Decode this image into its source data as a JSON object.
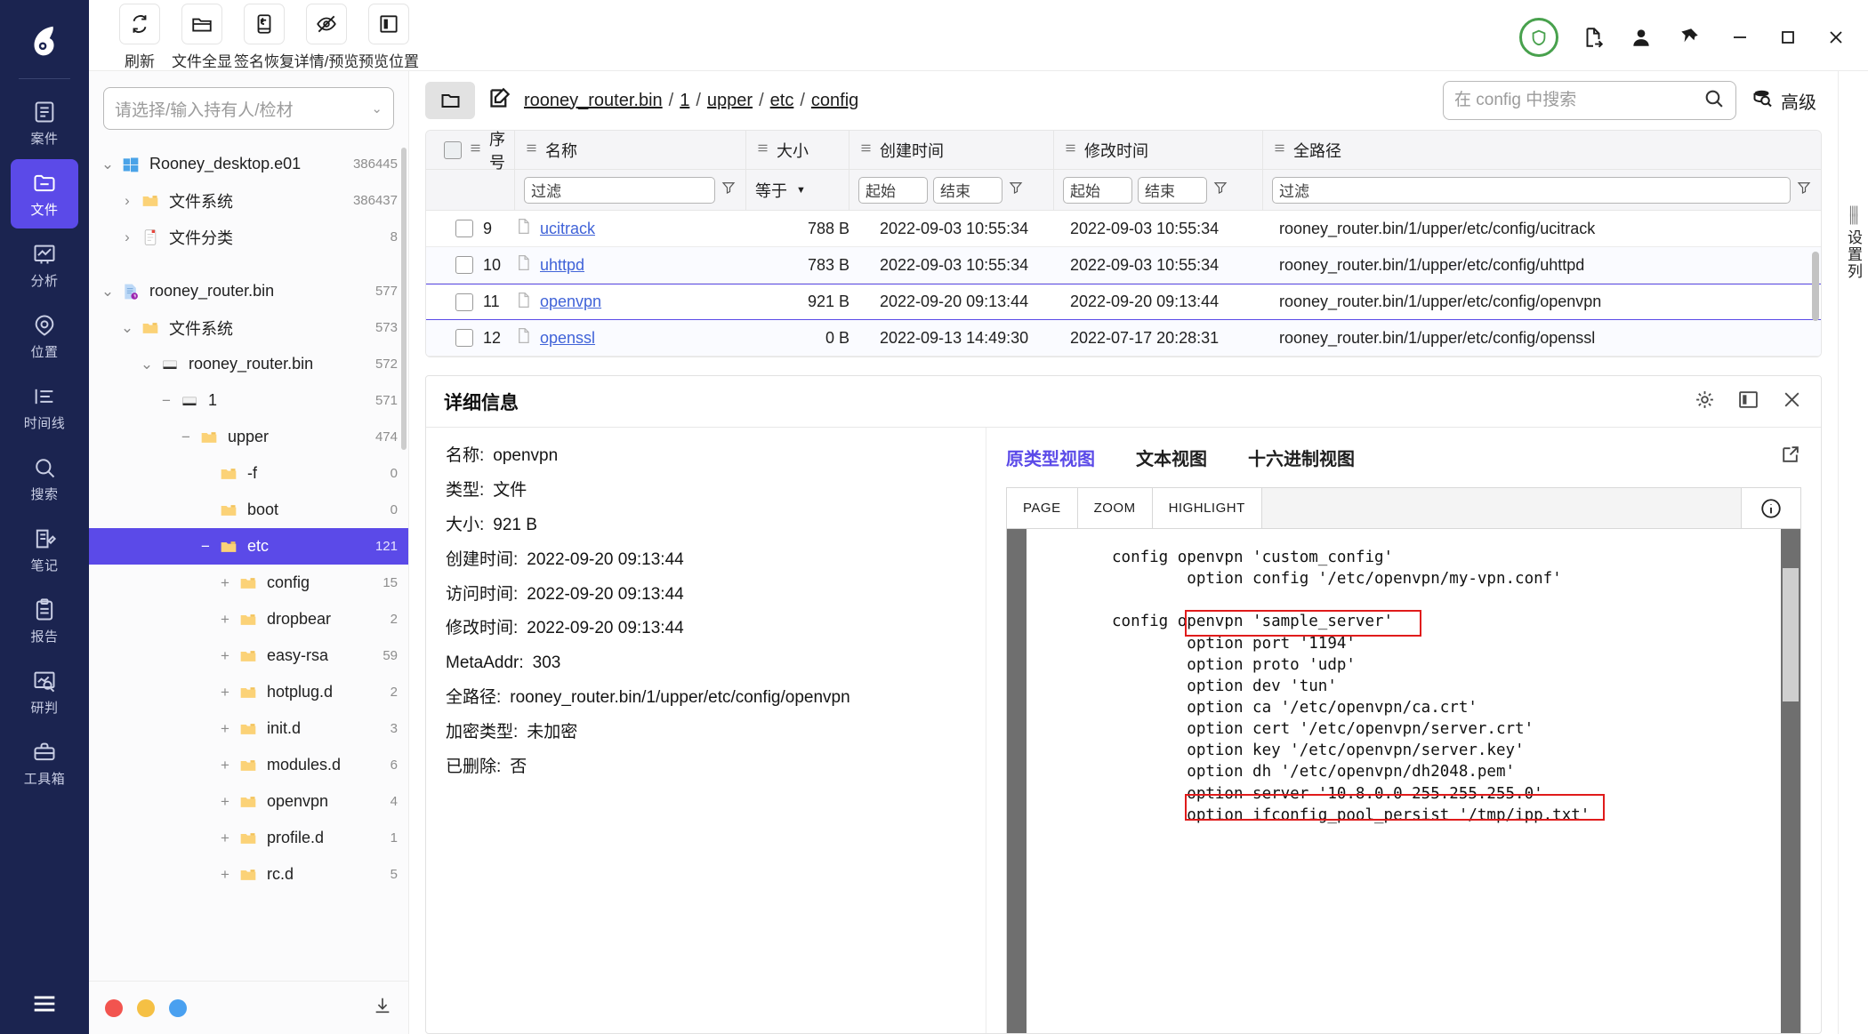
{
  "rail": {
    "items": [
      {
        "label": "案件",
        "icon": "case-icon",
        "active": false
      },
      {
        "label": "文件",
        "icon": "files-icon",
        "active": true
      },
      {
        "label": "分析",
        "icon": "analysis-icon",
        "active": false
      },
      {
        "label": "位置",
        "icon": "location-icon",
        "active": false
      },
      {
        "label": "时间线",
        "icon": "timeline-icon",
        "active": false
      },
      {
        "label": "搜索",
        "icon": "search-icon",
        "active": false
      },
      {
        "label": "笔记",
        "icon": "notes-icon",
        "active": false
      },
      {
        "label": "报告",
        "icon": "report-icon",
        "active": false
      },
      {
        "label": "研判",
        "icon": "judgement-icon",
        "active": false
      },
      {
        "label": "工具箱",
        "icon": "toolbox-icon",
        "active": false
      }
    ],
    "menu_icon": "hamburger-icon"
  },
  "toolbar": {
    "buttons": [
      {
        "label": "刷新",
        "icon": "refresh-icon"
      },
      {
        "label": "文件全显",
        "icon": "folder-icon"
      },
      {
        "label": "签名恢复",
        "icon": "signature-recovery-icon"
      },
      {
        "label": "详情/预览",
        "icon": "eye-off-icon"
      },
      {
        "label": "预览位置",
        "icon": "panel-position-icon"
      }
    ],
    "right_icons": [
      "shield-check-icon",
      "export-file-icon",
      "user-icon",
      "pin-icon"
    ],
    "window_controls": [
      "minimize-icon",
      "maximize-icon",
      "close-icon"
    ]
  },
  "tree": {
    "holder_placeholder": "请选择/输入持有人/检材",
    "chevron": "⌄",
    "nodes": [
      {
        "label": "Rooney_desktop.e01",
        "count": "386445",
        "indent": 0,
        "toggle": "⌄",
        "icon": "windows-icon",
        "selected": false
      },
      {
        "label": "文件系统",
        "count": "386437",
        "indent": 1,
        "toggle": "›",
        "icon": "folder-icon",
        "selected": false
      },
      {
        "label": "文件分类",
        "count": "8",
        "indent": 1,
        "toggle": "›",
        "icon": "doc-icon",
        "selected": false
      },
      {
        "label": "",
        "count": "",
        "indent": 0,
        "toggle": "",
        "icon": "gap",
        "selected": false
      },
      {
        "label": "rooney_router.bin",
        "count": "577",
        "indent": 0,
        "toggle": "⌄",
        "icon": "bin-icon",
        "selected": false
      },
      {
        "label": "文件系统",
        "count": "573",
        "indent": 1,
        "toggle": "⌄",
        "icon": "folder-icon",
        "selected": false
      },
      {
        "label": "rooney_router.bin",
        "count": "572",
        "indent": 2,
        "toggle": "⌄",
        "icon": "disk-icon",
        "selected": false
      },
      {
        "label": "1",
        "count": "571",
        "indent": 3,
        "toggle": "−",
        "icon": "disk-icon",
        "selected": false
      },
      {
        "label": "upper",
        "count": "474",
        "indent": 4,
        "toggle": "−",
        "icon": "folder-icon",
        "selected": false
      },
      {
        "label": "-f",
        "count": "0",
        "indent": 5,
        "toggle": "",
        "icon": "folder-icon",
        "selected": false
      },
      {
        "label": "boot",
        "count": "0",
        "indent": 5,
        "toggle": "",
        "icon": "folder-icon",
        "selected": false
      },
      {
        "label": "etc",
        "count": "121",
        "indent": 5,
        "toggle": "−",
        "icon": "folder-icon",
        "selected": true
      },
      {
        "label": "config",
        "count": "15",
        "indent": 6,
        "toggle": "+",
        "icon": "folder-icon",
        "selected": false
      },
      {
        "label": "dropbear",
        "count": "2",
        "indent": 6,
        "toggle": "+",
        "icon": "folder-icon",
        "selected": false
      },
      {
        "label": "easy-rsa",
        "count": "59",
        "indent": 6,
        "toggle": "+",
        "icon": "folder-icon",
        "selected": false
      },
      {
        "label": "hotplug.d",
        "count": "2",
        "indent": 6,
        "toggle": "+",
        "icon": "folder-icon",
        "selected": false
      },
      {
        "label": "init.d",
        "count": "3",
        "indent": 6,
        "toggle": "+",
        "icon": "folder-icon",
        "selected": false
      },
      {
        "label": "modules.d",
        "count": "6",
        "indent": 6,
        "toggle": "+",
        "icon": "folder-icon",
        "selected": false
      },
      {
        "label": "openvpn",
        "count": "4",
        "indent": 6,
        "toggle": "+",
        "icon": "folder-icon",
        "selected": false
      },
      {
        "label": "profile.d",
        "count": "1",
        "indent": 6,
        "toggle": "+",
        "icon": "folder-icon",
        "selected": false
      },
      {
        "label": "rc.d",
        "count": "5",
        "indent": 6,
        "toggle": "+",
        "icon": "folder-icon",
        "selected": false
      }
    ],
    "footer_dots": [
      "#f2544f",
      "#f5c044",
      "#49a0f0"
    ],
    "footer_icon": "download-icon"
  },
  "breadcrumb": {
    "folder_icon": "folder-icon",
    "edit_icon": "edit-icon",
    "parts": [
      "rooney_router.bin",
      "1",
      "upper",
      "etc",
      "config"
    ],
    "separator": "/"
  },
  "search": {
    "placeholder": "在 config 中搜索",
    "value": "",
    "icon": "search-icon",
    "advanced_label": "高级",
    "advanced_icon": "advanced-search-icon"
  },
  "table": {
    "columns": [
      {
        "label": "序号"
      },
      {
        "label": "名称"
      },
      {
        "label": "大小"
      },
      {
        "label": "创建时间"
      },
      {
        "label": "修改时间"
      },
      {
        "label": "全路径"
      }
    ],
    "filters": {
      "name_placeholder": "过滤",
      "size_operator": "等于",
      "date_start": "起始",
      "date_end": "结束",
      "fullpath_placeholder": "过滤"
    },
    "rows": [
      {
        "index": "9",
        "name": "ucitrack",
        "size": "788 B",
        "created": "2022-09-03 10:55:34",
        "modified": "2022-09-03 10:55:34",
        "fullpath": "rooney_router.bin/1/upper/etc/config/ucitrack",
        "checked": false,
        "highlight": false
      },
      {
        "index": "10",
        "name": "uhttpd",
        "size": "783 B",
        "created": "2022-09-03 10:55:34",
        "modified": "2022-09-03 10:55:34",
        "fullpath": "rooney_router.bin/1/upper/etc/config/uhttpd",
        "checked": false,
        "highlight": false
      },
      {
        "index": "11",
        "name": "openvpn",
        "size": "921 B",
        "created": "2022-09-20 09:13:44",
        "modified": "2022-09-20 09:13:44",
        "fullpath": "rooney_router.bin/1/upper/etc/config/openvpn",
        "checked": false,
        "highlight": true
      },
      {
        "index": "12",
        "name": "openssl",
        "size": "0 B",
        "created": "2022-09-13 14:49:30",
        "modified": "2022-07-17 20:28:31",
        "fullpath": "rooney_router.bin/1/upper/etc/config/openssl",
        "checked": false,
        "highlight": false
      }
    ]
  },
  "minirail": {
    "text": "设置列"
  },
  "detail": {
    "title": "详细信息",
    "header_icons": [
      "gear-icon",
      "panel-icon",
      "close-icon"
    ],
    "fields": [
      {
        "key": "名称:",
        "value": "openvpn"
      },
      {
        "key": "类型:",
        "value": "文件"
      },
      {
        "key": "大小:",
        "value": "921 B"
      },
      {
        "key": "创建时间:",
        "value": "2022-09-20 09:13:44"
      },
      {
        "key": "访问时间:",
        "value": "2022-09-20 09:13:44"
      },
      {
        "key": "修改时间:",
        "value": "2022-09-20 09:13:44"
      },
      {
        "key": "MetaAddr:",
        "value": "303"
      },
      {
        "key": "全路径:",
        "value": "rooney_router.bin/1/upper/etc/config/openvpn"
      },
      {
        "key": "加密类型:",
        "value": "未加密"
      },
      {
        "key": "已删除:",
        "value": "否"
      }
    ]
  },
  "preview": {
    "tabs": [
      {
        "label": "原类型视图",
        "active": true
      },
      {
        "label": "文本视图",
        "active": false
      },
      {
        "label": "十六进制视图",
        "active": false
      }
    ],
    "expand_icon": "external-link-icon",
    "viewer_buttons": [
      "PAGE",
      "ZOOM",
      "HIGHLIGHT"
    ],
    "info_icon": "info-icon",
    "code": "config openvpn 'custom_config'\n        option config '/etc/openvpn/my-vpn.conf'\n\nconfig openvpn 'sample_server'\n        option port '1194'\n        option proto 'udp'\n        option dev 'tun'\n        option ca '/etc/openvpn/ca.crt'\n        option cert '/etc/openvpn/server.crt'\n        option key '/etc/openvpn/server.key'\n        option dh '/etc/openvpn/dh2048.pem'\n        option server '10.8.0.0 255.255.255.0'\n        option ifconfig_pool_persist '/tmp/ipp.txt'",
    "highlights": [
      {
        "label": "option port '1194'",
        "color": "#e01b1b"
      },
      {
        "label": "option server '10.8.0.0 255.255.255.0'",
        "color": "#e01b1b"
      }
    ]
  }
}
